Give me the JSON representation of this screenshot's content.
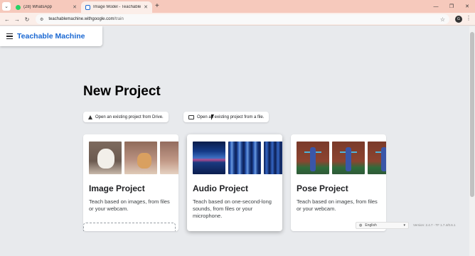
{
  "browser": {
    "tabs": [
      {
        "title": "(28) WhatsApp",
        "icon": "whatsapp-icon",
        "active": false
      },
      {
        "title": "Image Model - Teachable Machine",
        "icon": "teachable-machine-icon",
        "active": true
      }
    ],
    "new_tab": "+",
    "url_host": "teachablemachine.withgoogle.com",
    "url_path": "/train",
    "profile_initial": "G"
  },
  "app": {
    "brand": "Teachable Machine",
    "page_title": "New Project",
    "open_drive_label": "Open an existing project from Drive.",
    "open_file_label": "Open an existing project from a file."
  },
  "cards": [
    {
      "title": "Image Project",
      "desc": "Teach based on images, from files or your webcam."
    },
    {
      "title": "Audio Project",
      "desc": "Teach based on one-second-long sounds, from files or your microphone."
    },
    {
      "title": "Pose Project",
      "desc": "Teach based on images, from files or your webcam."
    }
  ],
  "footer": {
    "language": "English",
    "version": "Version: 2.4.7 - TF 1.7.4/0.6.1"
  },
  "colors": {
    "brand": "#1967d2",
    "tabstrip": "#f6c9bc",
    "page_bg": "#e8eaed"
  }
}
